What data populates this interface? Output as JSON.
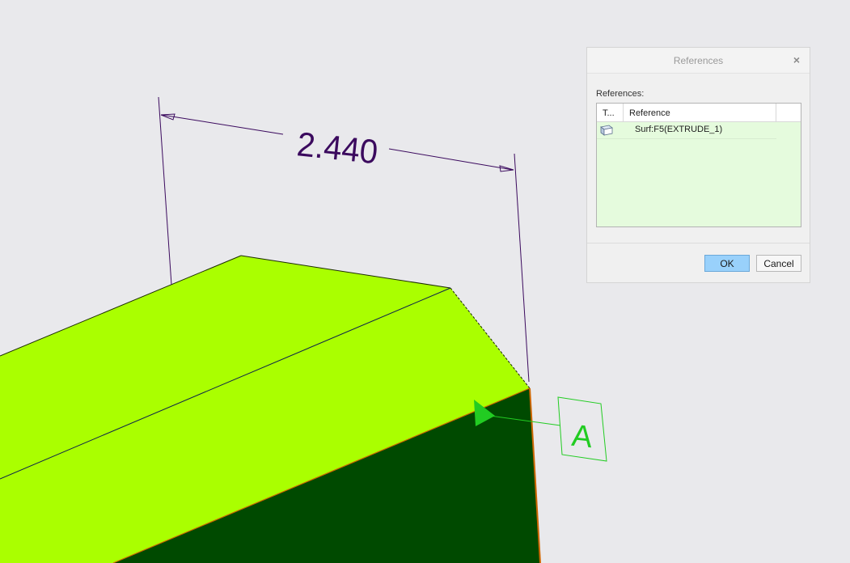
{
  "viewport": {
    "dimension_value": "2.440",
    "datum_label": "A",
    "colors": {
      "background": "#e9e9ec",
      "top_face": "#aaff00",
      "front_face": "#004a00",
      "dimension_text": "#3b0a5e",
      "datum": "#22cc22"
    }
  },
  "dialog": {
    "title": "References",
    "close_icon": "close-icon",
    "section_label": "References:",
    "table": {
      "headers": [
        "T...",
        "Reference"
      ],
      "rows": [
        {
          "icon": "surface-icon",
          "reference": "Surf:F5(EXTRUDE_1)"
        }
      ]
    },
    "ok_label": "OK",
    "cancel_label": "Cancel"
  }
}
